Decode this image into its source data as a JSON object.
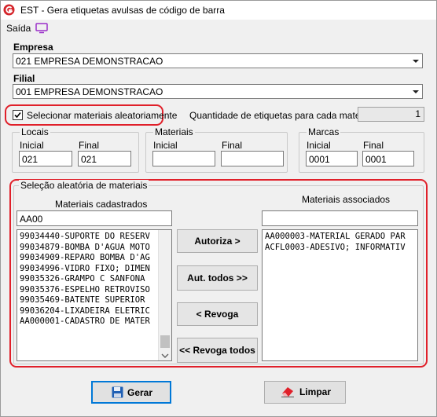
{
  "window": {
    "title": "EST - Gera etiquetas avulsas de código de barra",
    "app_icon": "app-logo-icon"
  },
  "menu": {
    "saida_label": "Saída",
    "saida_icon": "monitor-icon"
  },
  "empresa": {
    "label": "Empresa",
    "value": "021 EMPRESA DEMONSTRACAO"
  },
  "filial": {
    "label": "Filial",
    "value": "001 EMPRESA DEMONSTRACAO"
  },
  "aleatorio": {
    "checkbox_label": "Selecionar materiais aleatoriamente",
    "checked": true
  },
  "quantidade": {
    "label": "Quantidade de etiquetas para cada material",
    "value": "1"
  },
  "locais": {
    "title": "Locais",
    "inicial_label": "Inicial",
    "final_label": "Final",
    "inicial_value": "021",
    "final_value": "021"
  },
  "materiais_range": {
    "title": "Materiais",
    "inicial_label": "Inicial",
    "final_label": "Final",
    "inicial_value": "",
    "final_value": ""
  },
  "marcas": {
    "title": "Marcas",
    "inicial_label": "Inicial",
    "final_label": "Final",
    "inicial_value": "0001",
    "final_value": "0001"
  },
  "selecao": {
    "title": "Seleção aleatória de materiais",
    "cadastrados_label": "Materiais cadastrados",
    "cadastrados_filter": "AA00",
    "cadastrados_items": [
      "99034440-SUPORTE DO RESERV",
      "99034879-BOMBA D'AGUA MOTO",
      "99034909-REPARO BOMBA D'AG",
      "99034996-VIDRO FIXO; DIMEN",
      "99035326-GRAMPO C SANFONA ",
      "99035376-ESPELHO RETROVISO",
      "99035469-BATENTE SUPERIOR ",
      "99036204-LIXADEIRA ELETRIC",
      "AA000001-CADASTRO DE MATER"
    ],
    "associados_label": "Materiais associados",
    "associados_filter": "",
    "associados_items": [
      "AA000003-MATERIAL GERADO PAR",
      "ACFL0003-ADESIVO; INFORMATIV"
    ],
    "btn_autoriza": "Autoriza >",
    "btn_aut_todos": "Aut. todos >>",
    "btn_revoga": "< Revoga",
    "btn_revoga_todos": "<< Revoga todos"
  },
  "footer": {
    "gerar_label": "Gerar",
    "gerar_icon": "save-icon",
    "limpar_label": "Limpar",
    "limpar_icon": "eraser-icon"
  },
  "colors": {
    "highlight_red": "#e0202a",
    "focus_blue": "#0078d7",
    "menu_icon_purple": "#9b2fc9"
  }
}
